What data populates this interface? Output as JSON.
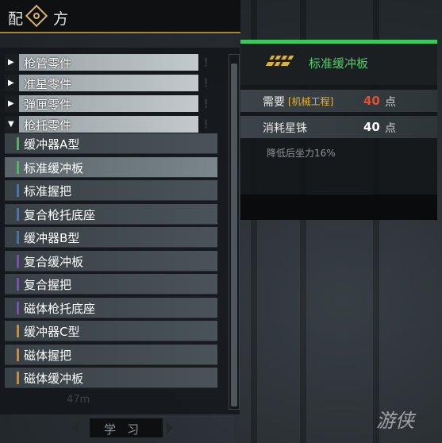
{
  "title": {
    "char1": "配",
    "char2": "方",
    "icon": "recipe-gear-icon"
  },
  "categories": [
    {
      "label": "枪管零件",
      "expanded": false,
      "arrow": "▶",
      "bang": "!"
    },
    {
      "label": "准星零件",
      "expanded": false,
      "arrow": "▶",
      "bang": "!"
    },
    {
      "label": "弹匣零件",
      "expanded": false,
      "arrow": "▶",
      "bang": "!"
    },
    {
      "label": "枪托零件",
      "expanded": true,
      "arrow": "▼",
      "bang": "!"
    }
  ],
  "items": [
    {
      "label": "缓冲器A型",
      "tier_color": "#3fc04f"
    },
    {
      "label": "标准缓冲板",
      "tier_color": "#3fc04f",
      "selected": true
    },
    {
      "label": "标准握把",
      "tier_color": "#3b78b8"
    },
    {
      "label": "复合枪托底座",
      "tier_color": "#3b78b8"
    },
    {
      "label": "缓冲器B型",
      "tier_color": "#3b78b8"
    },
    {
      "label": "复合缓冲板",
      "tier_color": "#7a4cc4"
    },
    {
      "label": "复合握把",
      "tier_color": "#7a4cc4"
    },
    {
      "label": "磁体枪托底座",
      "tier_color": "#7a4cc4"
    },
    {
      "label": "缓冲器C型",
      "tier_color": "#d48a1e"
    },
    {
      "label": "磁体握把",
      "tier_color": "#d48a1e"
    },
    {
      "label": "磁体缓冲板",
      "tier_color": "#d48a1e"
    }
  ],
  "distance": "47m",
  "learn_button": "学习",
  "detail": {
    "name": "标准缓冲板",
    "icon": "buffer-plate-icon",
    "requirements": [
      {
        "label": "需要",
        "skill": "[机械工程]",
        "value": "40",
        "unit": "点",
        "value_color": "#f04a2a"
      },
      {
        "label": "消耗星铢",
        "skill": "",
        "value": "40",
        "unit": "点",
        "value_color": "#ffffff"
      }
    ],
    "description": "降低后坐力16%"
  },
  "watermark": "游侠网"
}
